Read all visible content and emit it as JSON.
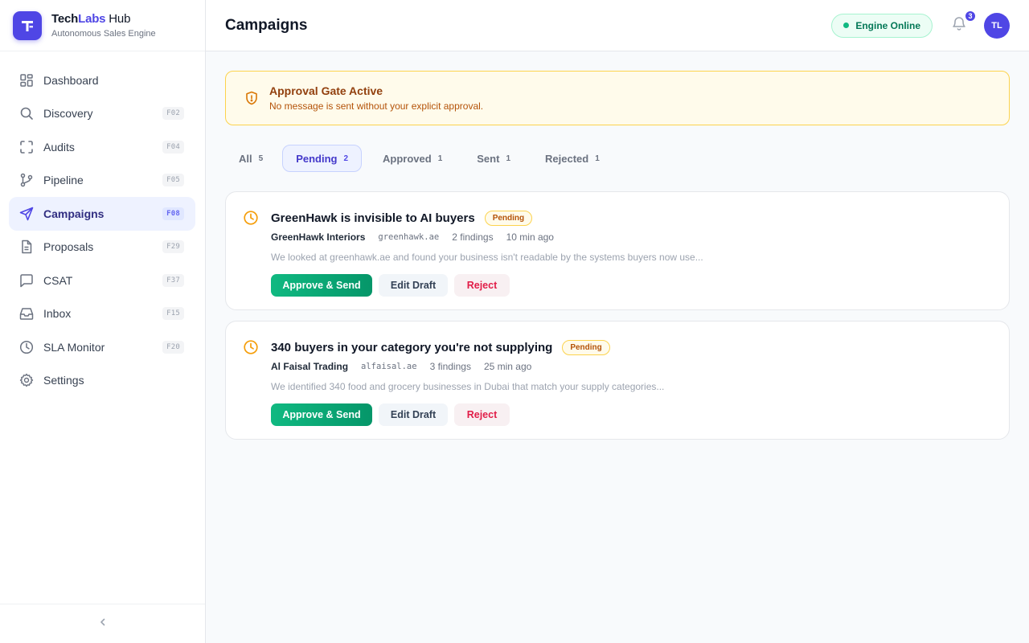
{
  "brand": {
    "name_part1": "Tech",
    "name_part2": "Labs",
    "name_part3": " Hub",
    "subtitle": "Autonomous Sales Engine",
    "logo_icon": "techlabs-logo-icon"
  },
  "sidebar": {
    "items": [
      {
        "label": "Dashboard",
        "icon": "grid-icon",
        "kbd": ""
      },
      {
        "label": "Discovery",
        "icon": "search-icon",
        "kbd": "F02"
      },
      {
        "label": "Audits",
        "icon": "scan-icon",
        "kbd": "F04"
      },
      {
        "label": "Pipeline",
        "icon": "git-branch-icon",
        "kbd": "F05"
      },
      {
        "label": "Campaigns",
        "icon": "send-icon",
        "kbd": "F08",
        "active": true
      },
      {
        "label": "Proposals",
        "icon": "document-icon",
        "kbd": "F29"
      },
      {
        "label": "CSAT",
        "icon": "message-square-icon",
        "kbd": "F37"
      },
      {
        "label": "Inbox",
        "icon": "inbox-icon",
        "kbd": "F15"
      },
      {
        "label": "SLA Monitor",
        "icon": "clock-icon",
        "kbd": "F20"
      },
      {
        "label": "Settings",
        "icon": "gear-icon",
        "kbd": ""
      }
    ],
    "collapse_icon": "chevron-left-icon"
  },
  "header": {
    "title": "Campaigns",
    "engine_status": "Engine Online",
    "notification_count": "3",
    "avatar_initials": "TL"
  },
  "banner": {
    "title": "Approval Gate Active",
    "message": "No message is sent without your explicit approval.",
    "icon": "shield-alert-icon"
  },
  "tabs": [
    {
      "label": "All",
      "count": "5"
    },
    {
      "label": "Pending",
      "count": "2",
      "active": true
    },
    {
      "label": "Approved",
      "count": "1"
    },
    {
      "label": "Sent",
      "count": "1"
    },
    {
      "label": "Rejected",
      "count": "1"
    }
  ],
  "campaigns": [
    {
      "title": "GreenHawk is invisible to AI buyers",
      "status": "Pending",
      "company": "GreenHawk Interiors",
      "domain": "greenhawk.ae",
      "findings": "2 findings",
      "time": "10 min ago",
      "excerpt": "We looked at greenhawk.ae and found your business isn't readable by the systems buyers now use..."
    },
    {
      "title": "340 buyers in your category you're not supplying",
      "status": "Pending",
      "company": "Al Faisal Trading",
      "domain": "alfaisal.ae",
      "findings": "3 findings",
      "time": "25 min ago",
      "excerpt": "We identified 340 food and grocery businesses in Dubai that match your supply categories..."
    }
  ],
  "actions": {
    "approve": "Approve & Send",
    "edit": "Edit Draft",
    "reject": "Reject"
  },
  "colors": {
    "accent": "#4f46e5",
    "success": "#10b981",
    "warning": "#f59e0b",
    "danger": "#e11d48"
  }
}
